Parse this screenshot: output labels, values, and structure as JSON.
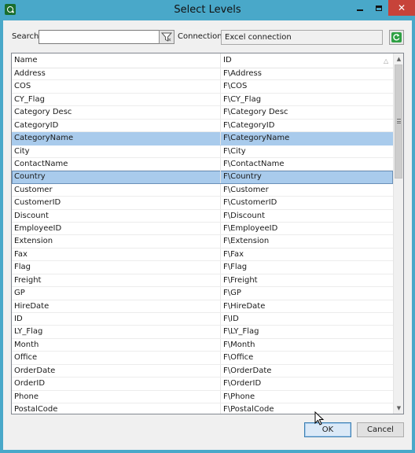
{
  "window": {
    "title": "Select Levels",
    "close_glyph": "✕"
  },
  "toolbar": {
    "search_label": "Search",
    "search_value": "",
    "connection_label": "Connection",
    "connection_value": "Excel connection"
  },
  "table": {
    "columns": [
      "Name",
      "ID"
    ],
    "sort_indicator": "△",
    "rows": [
      {
        "name": "Address",
        "id": "F\\Address"
      },
      {
        "name": "COS",
        "id": "F\\COS"
      },
      {
        "name": "CY_Flag",
        "id": "F\\CY_Flag"
      },
      {
        "name": "Category Desc",
        "id": "F\\Category Desc"
      },
      {
        "name": "CategoryID",
        "id": "F\\CategoryID"
      },
      {
        "name": "CategoryName",
        "id": "F\\CategoryName"
      },
      {
        "name": "City",
        "id": "F\\City"
      },
      {
        "name": "ContactName",
        "id": "F\\ContactName"
      },
      {
        "name": "Country",
        "id": "F\\Country"
      },
      {
        "name": "Customer",
        "id": "F\\Customer"
      },
      {
        "name": "CustomerID",
        "id": "F\\CustomerID"
      },
      {
        "name": "Discount",
        "id": "F\\Discount"
      },
      {
        "name": "EmployeeID",
        "id": "F\\EmployeeID"
      },
      {
        "name": "Extension",
        "id": "F\\Extension"
      },
      {
        "name": "Fax",
        "id": "F\\Fax"
      },
      {
        "name": "Flag",
        "id": "F\\Flag"
      },
      {
        "name": "Freight",
        "id": "F\\Freight"
      },
      {
        "name": "GP",
        "id": "F\\GP"
      },
      {
        "name": "HireDate",
        "id": "F\\HireDate"
      },
      {
        "name": "ID",
        "id": "F\\ID"
      },
      {
        "name": "LY_Flag",
        "id": "F\\LY_Flag"
      },
      {
        "name": "Month",
        "id": "F\\Month"
      },
      {
        "name": "Office",
        "id": "F\\Office"
      },
      {
        "name": "OrderDate",
        "id": "F\\OrderDate"
      },
      {
        "name": "OrderID",
        "id": "F\\OrderID"
      },
      {
        "name": "Phone",
        "id": "F\\Phone"
      },
      {
        "name": "PostalCode",
        "id": "F\\PostalCode"
      }
    ],
    "selected_rows": [
      "CategoryName",
      "Country"
    ],
    "focused_row": "Country"
  },
  "buttons": {
    "ok_label": "OK",
    "cancel_label": "Cancel"
  },
  "colors": {
    "titlebar": "#49a8c9",
    "close_button": "#c7433a",
    "selection": "#a9cbec",
    "refresh_icon": "#2ea043"
  }
}
